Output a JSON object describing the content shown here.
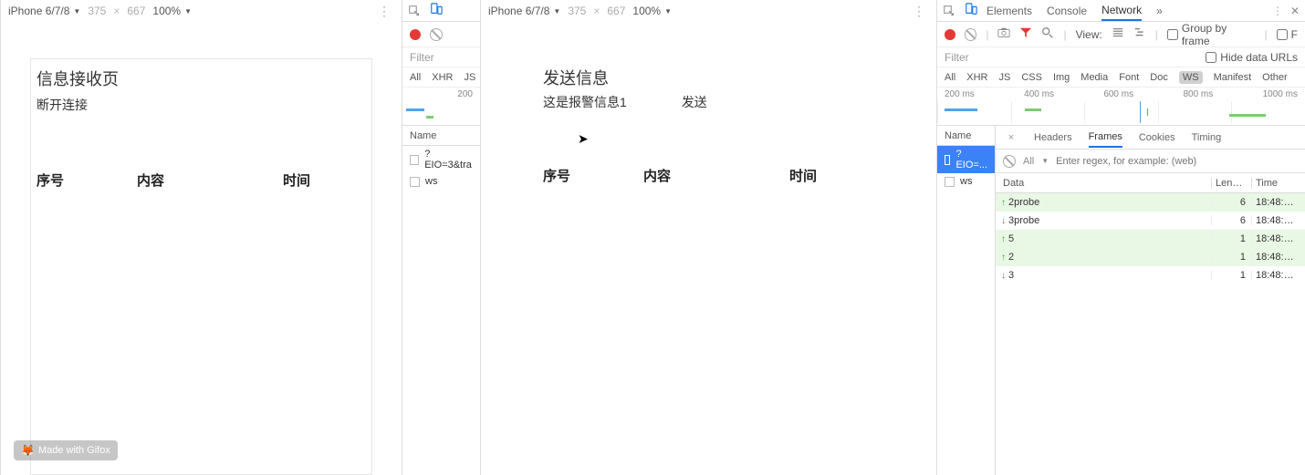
{
  "left": {
    "device_toolbar": {
      "device": "iPhone 6/7/8",
      "w": "375",
      "h": "667",
      "x": "×",
      "zoom": "100%",
      "kebab": "⋮"
    },
    "page": {
      "title": "信息接收页",
      "disconnect": "断开连接",
      "c1": "序号",
      "c2": "内容",
      "c3": "时间"
    },
    "watermark": "Made with Gifox"
  },
  "dt1": {
    "toolbar": {
      "record": "●"
    },
    "filter": {
      "label": "Filter"
    },
    "types": {
      "all": "All",
      "xhr": "XHR",
      "js": "JS"
    },
    "tick": "200",
    "list": {
      "name_hdr": "Name",
      "r1": "?EIO=3&tra",
      "r2": "ws"
    }
  },
  "mid": {
    "device_toolbar": {
      "device": "iPhone 6/7/8",
      "w": "375",
      "h": "667",
      "x": "×",
      "zoom": "100%",
      "kebab": "⋮"
    },
    "page": {
      "title": "发送信息",
      "msg": "这是报警信息1",
      "send": "发送",
      "c1": "序号",
      "c2": "内容",
      "c3": "时间"
    }
  },
  "dt2": {
    "tabs": {
      "elements": "Elements",
      "console": "Console",
      "network": "Network",
      "more": "»"
    },
    "ctrl": {
      "view": "View:",
      "group": "Group by frame"
    },
    "filter": {
      "label": "Filter",
      "hide": "Hide data URLs"
    },
    "types": {
      "all": "All",
      "xhr": "XHR",
      "js": "JS",
      "css": "CSS",
      "img": "Img",
      "media": "Media",
      "font": "Font",
      "doc": "Doc",
      "ws": "WS",
      "manifest": "Manifest",
      "other": "Other"
    },
    "ticks": [
      "200 ms",
      "400 ms",
      "600 ms",
      "800 ms",
      "1000 ms"
    ],
    "list": {
      "name_hdr": "Name",
      "r1": "?EIO=...",
      "r2": "ws"
    },
    "subtabs": {
      "headers": "Headers",
      "frames": "Frames",
      "cookies": "Cookies",
      "timing": "Timing"
    },
    "frametool": {
      "all": "All",
      "placeholder": "Enter regex, for example: (web)"
    },
    "datatable": {
      "hdrD": "Data",
      "hdrL": "Len…",
      "hdrT": "Time",
      "rows": [
        {
          "dir": "up",
          "d": "2probe",
          "l": "6",
          "t": "18:48:…"
        },
        {
          "dir": "down",
          "d": "3probe",
          "l": "6",
          "t": "18:48:…"
        },
        {
          "dir": "up",
          "d": "5",
          "l": "1",
          "t": "18:48:…"
        },
        {
          "dir": "up",
          "d": "2",
          "l": "1",
          "t": "18:48:…"
        },
        {
          "dir": "down",
          "d": "3",
          "l": "1",
          "t": "18:48:…"
        }
      ]
    }
  }
}
